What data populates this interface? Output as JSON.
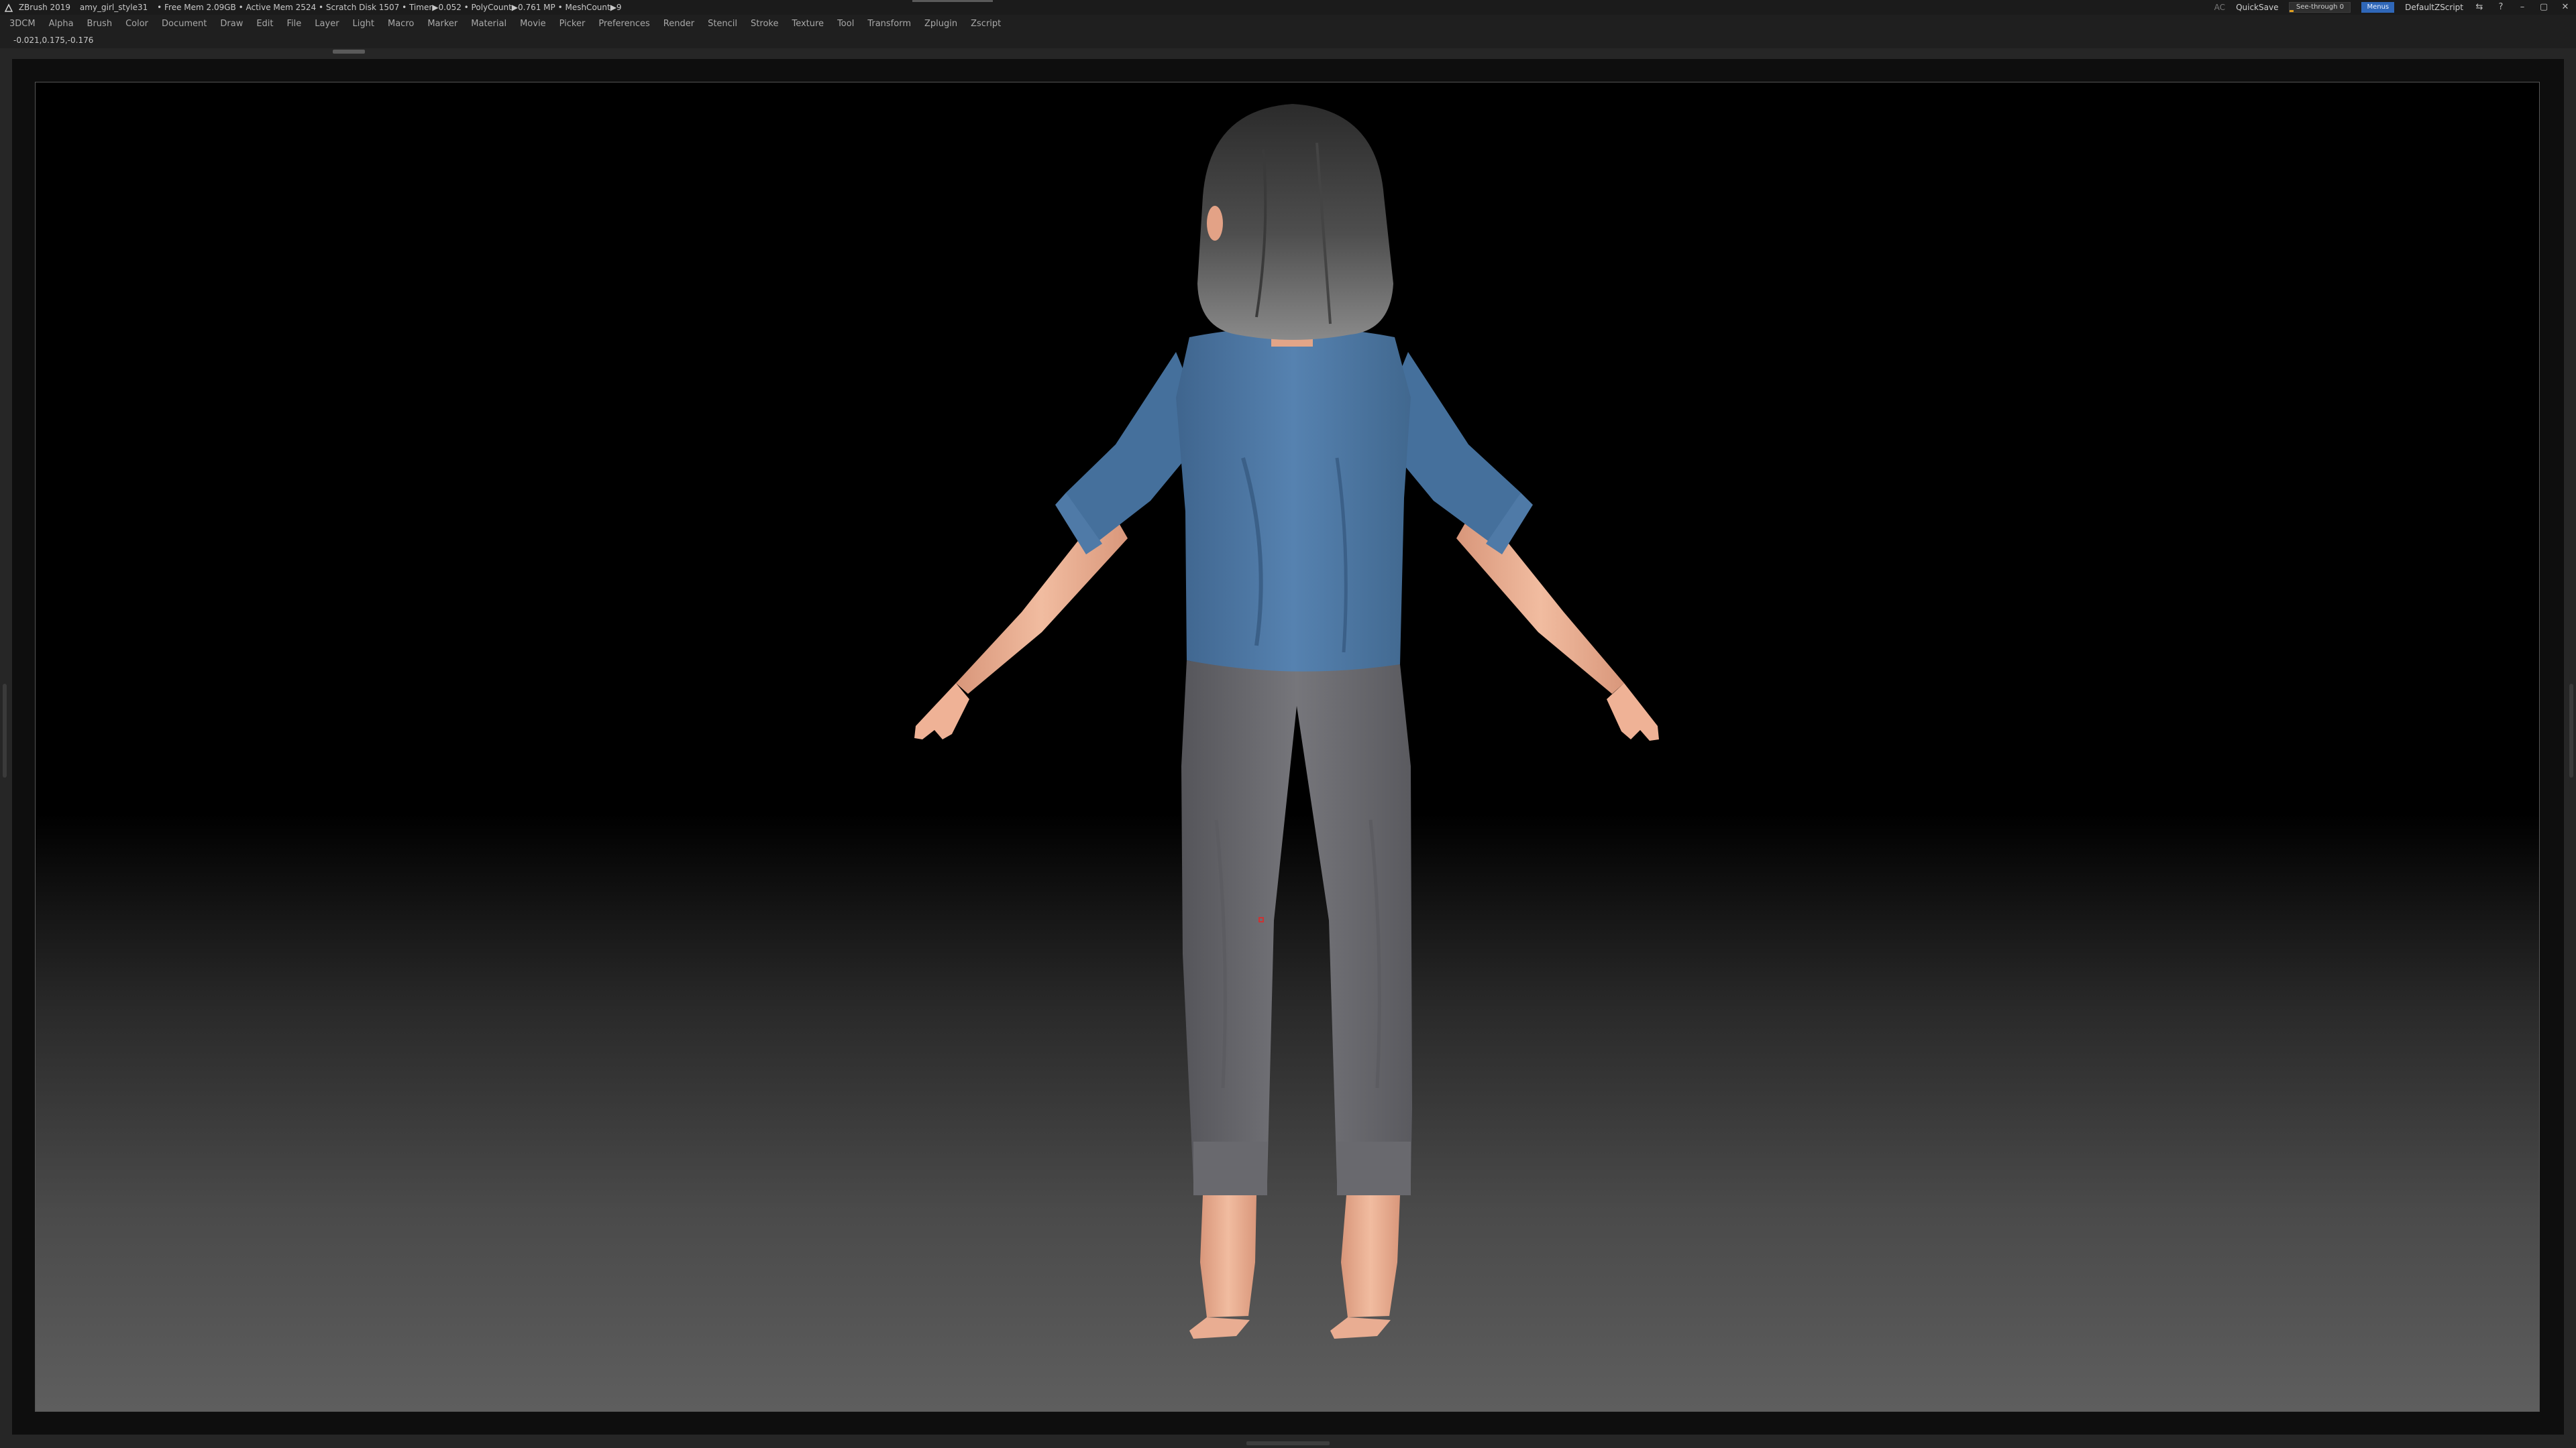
{
  "titlebar": {
    "app": "ZBrush 2019",
    "file": "amy_girl_style31",
    "stats": "• Free Mem 2.09GB • Active Mem 2524 • Scratch Disk 1507 • Timer▶0.052 • PolyCount▶0.761 MP • MeshCount▶9",
    "ac_label": "AC",
    "quicksave_label": "QuickSave",
    "see_through_label": "See-through 0",
    "see_through_value": 0,
    "menus_label": "Menus",
    "script_label": "DefaultZScript"
  },
  "menu": {
    "items": [
      "3DCM",
      "Alpha",
      "Brush",
      "Color",
      "Document",
      "Draw",
      "Edit",
      "File",
      "Layer",
      "Light",
      "Macro",
      "Marker",
      "Material",
      "Movie",
      "Picker",
      "Preferences",
      "Render",
      "Stencil",
      "Stroke",
      "Texture",
      "Tool",
      "Transform",
      "Zplugin",
      "Zscript"
    ]
  },
  "status": {
    "coordinates": "-0.021,0.175,-0.176"
  },
  "colors": {
    "shirt": "#4f79a6",
    "pants": "#6c6c70",
    "skin": "#e6a98a",
    "hair": "#5a5a5a",
    "accent_menus": "#2f67b8",
    "see_through_fill": "#e0a020"
  },
  "icons": [
    "zbrush-logo-icon",
    "layout-icon",
    "help-icon",
    "minimize-icon",
    "maximize-icon",
    "close-icon"
  ]
}
